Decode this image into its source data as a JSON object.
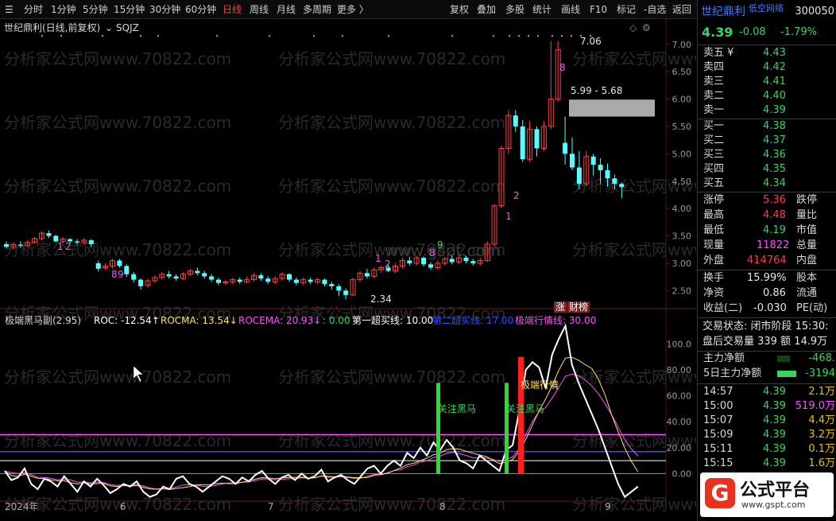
{
  "toolbar": {
    "left_items": [
      "分时",
      "1分钟",
      "5分钟",
      "15分钟",
      "30分钟",
      "60分钟",
      "日线",
      "周线",
      "月线",
      "多周期",
      "更多 〉"
    ],
    "active": "日线",
    "right_items": [
      "复权",
      "叠加",
      "多股",
      "统计",
      "画线",
      "F10",
      "标记",
      "-自选",
      "返回"
    ]
  },
  "chart": {
    "title": "世纪鼎利(日线,前复权)",
    "indicator_name": "SQJZ",
    "watermark": "分析家公式网www.70822.com",
    "watermark2": "www.gspt.com",
    "price_axis": [
      "7.00",
      "6.50",
      "6.00",
      "5.50",
      "5.00",
      "4.50",
      "4.00",
      "3.50",
      "3.00",
      "2.50"
    ],
    "high_label": "7.06",
    "low_label": "2.34",
    "range_label": "5.99 - 5.68",
    "badges": [
      "涨",
      "财榜"
    ],
    "counts": [
      "1",
      "2",
      "8",
      "9",
      "1",
      "2",
      "9",
      "8",
      "1",
      "2",
      "8"
    ]
  },
  "indicator": {
    "name": "极端黑马副(2.95)",
    "fields": [
      {
        "label": "ROC: -12.54↑",
        "color": "#ffffff"
      },
      {
        "label": "ROCMA: 13.54↓",
        "color": "#ffe066"
      },
      {
        "label": "ROCEMA: 20.93↓",
        "color": "#ff4fff"
      },
      {
        "label": ": 0.00",
        "color": "#3ad35b"
      },
      {
        "label": "第一超买线: 10.00",
        "color": "#ffffff"
      },
      {
        "label": "第二超买线: 17.00",
        "color": "#3050ff"
      },
      {
        "label": "极端行情线: 30.00",
        "color": "#ff4fff"
      }
    ],
    "axis": [
      "100.0",
      "80.00",
      "60.00",
      "40.00",
      "20.00",
      "0.00"
    ],
    "labels": [
      "关注黑马",
      "关注黑马",
      "极端行情"
    ]
  },
  "date_axis": [
    "2024年",
    "6",
    "7",
    "8",
    "9"
  ],
  "quote": {
    "name": "世纪鼎利",
    "code": "300050",
    "sector": "低空网络",
    "price": "4.39",
    "change": "-0.08",
    "pct": "-1.79%",
    "sell": [
      {
        "label": "卖五 ¥",
        "price": "4.43"
      },
      {
        "label": "卖四",
        "price": "4.42"
      },
      {
        "label": "卖三",
        "price": "4.41"
      },
      {
        "label": "卖二",
        "price": "4.40"
      },
      {
        "label": "卖一",
        "price": "4.39"
      }
    ],
    "buy": [
      {
        "label": "买一",
        "price": "4.38"
      },
      {
        "label": "买二",
        "price": "4.37"
      },
      {
        "label": "买三",
        "price": "4.36"
      },
      {
        "label": "买四",
        "price": "4.35"
      },
      {
        "label": "买五",
        "price": "4.34"
      }
    ],
    "stats": [
      {
        "l": "涨停",
        "v": "5.36",
        "l2": "跌停",
        "c": "red"
      },
      {
        "l": "最高",
        "v": "4.48",
        "l2": "量比",
        "c": "red"
      },
      {
        "l": "最低",
        "v": "4.19",
        "l2": "市值",
        "c": "green"
      },
      {
        "l": "现量",
        "v": "11822",
        "l2": "总量",
        "c": "mag"
      },
      {
        "l": "外盘",
        "v": "414764",
        "l2": "内盘",
        "c": "red"
      }
    ],
    "stats2": [
      {
        "l": "换手",
        "v": "15.99%",
        "l2": "股本"
      },
      {
        "l": "净资",
        "v": "0.86",
        "l2": "流通"
      },
      {
        "l": "收益(二)",
        "v": "-0.030",
        "l2": "PE(动)"
      }
    ],
    "status": "交易状态: 闭市阶段 15:30:",
    "after_hours": "盘后交易量 339 额 14.9万",
    "flow": [
      {
        "l": "主力净额",
        "v": "-468.",
        "bar": 0.3
      },
      {
        "l": "5日主力净额",
        "v": "-3194",
        "bar": 0.7
      }
    ],
    "ticks": [
      {
        "t": "14:57",
        "p": "4.39",
        "v": "2.1万"
      },
      {
        "t": "15:00",
        "p": "4.39",
        "v": "519.0万"
      },
      {
        "t": "15:07",
        "p": "4.39",
        "v": "4.4万"
      },
      {
        "t": "15:09",
        "p": "4.39",
        "v": "3.2万"
      },
      {
        "t": "15:11",
        "p": "4.39",
        "v": "0.1万"
      },
      {
        "t": "15:15",
        "p": "4.39",
        "v": "1.6万"
      }
    ],
    "brand": "公式平台",
    "brand_url": "www.gspt.com"
  }
}
